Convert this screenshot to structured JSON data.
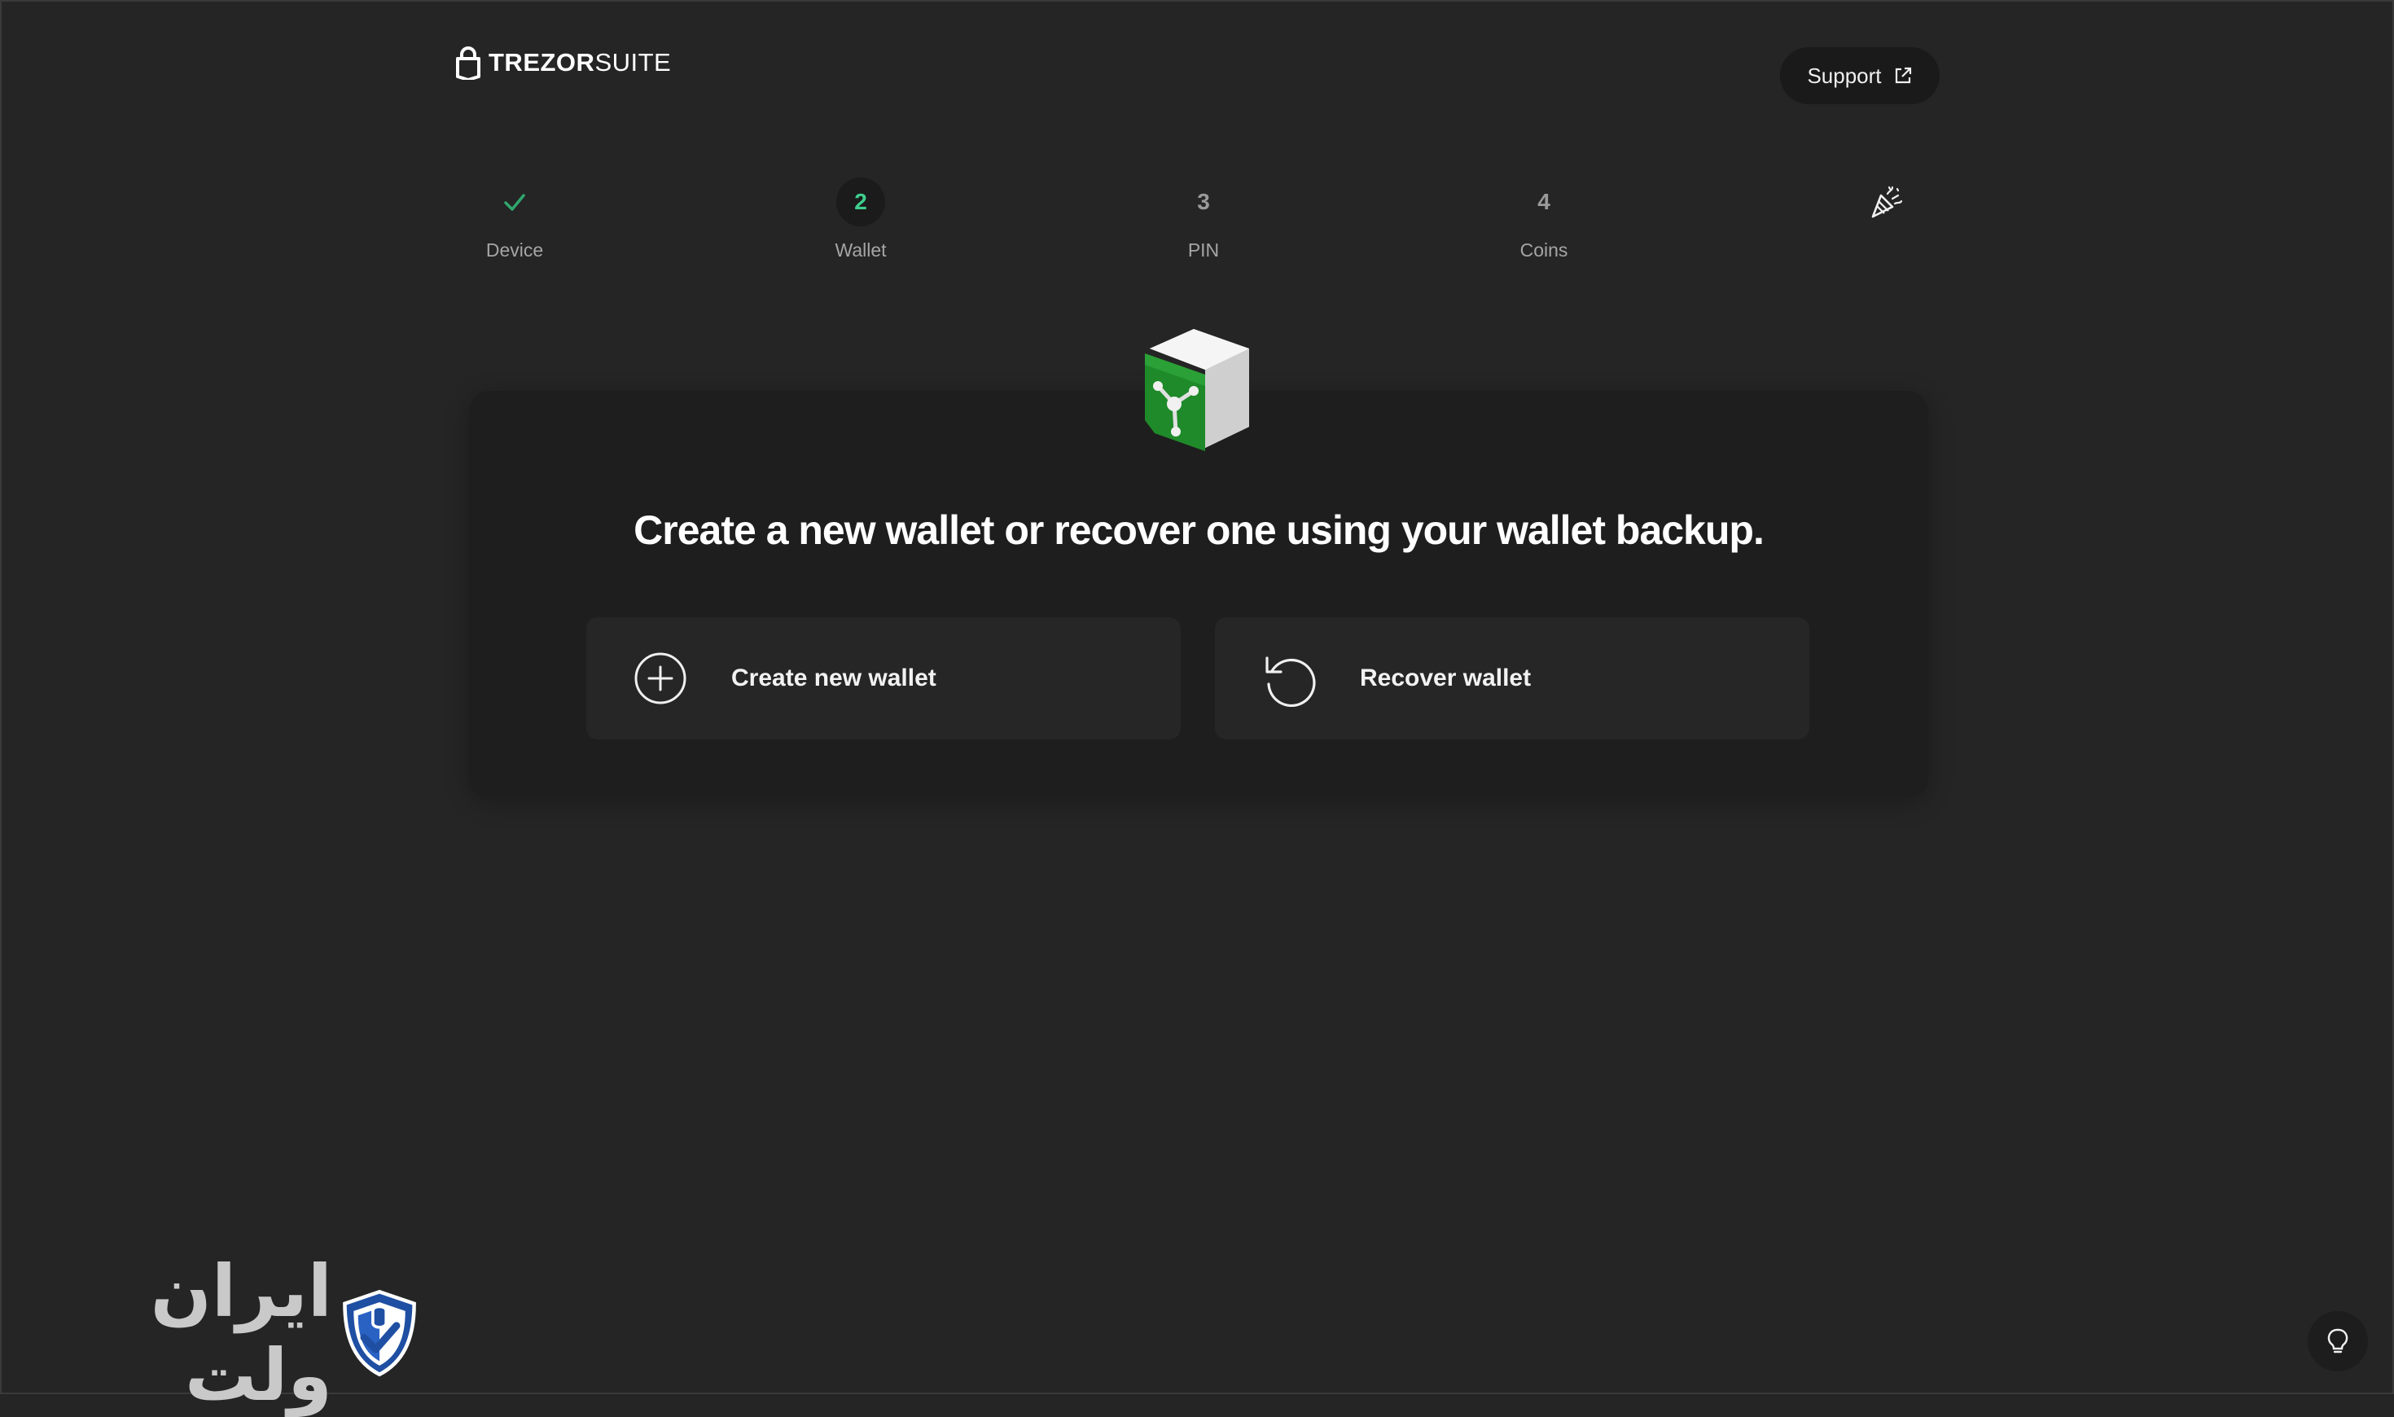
{
  "header": {
    "logo_trezor": "TREZOR",
    "logo_suite": "SUITE",
    "support_label": "Support"
  },
  "steps": [
    {
      "marker": "",
      "label": "Device",
      "state": "done"
    },
    {
      "marker": "2",
      "label": "Wallet",
      "state": "active"
    },
    {
      "marker": "3",
      "label": "PIN",
      "state": "pending"
    },
    {
      "marker": "4",
      "label": "Coins",
      "state": "pending"
    },
    {
      "marker": "",
      "label": "",
      "state": "final",
      "icon": "party-popper-icon"
    }
  ],
  "main": {
    "headline": "Create a new wallet or recover one using your wallet backup.",
    "options": [
      {
        "label": "Create new wallet",
        "icon": "plus-circle-icon"
      },
      {
        "label": "Recover wallet",
        "icon": "recover-arrow-icon"
      }
    ]
  },
  "watermark": {
    "text": "ایران ولت",
    "icon": "shield-check-icon"
  },
  "colors": {
    "background": "#252525",
    "card": "#1e1e1e",
    "option": "#262626",
    "accent": "#3ecf8e",
    "brand_blue": "#1f4fa3"
  }
}
